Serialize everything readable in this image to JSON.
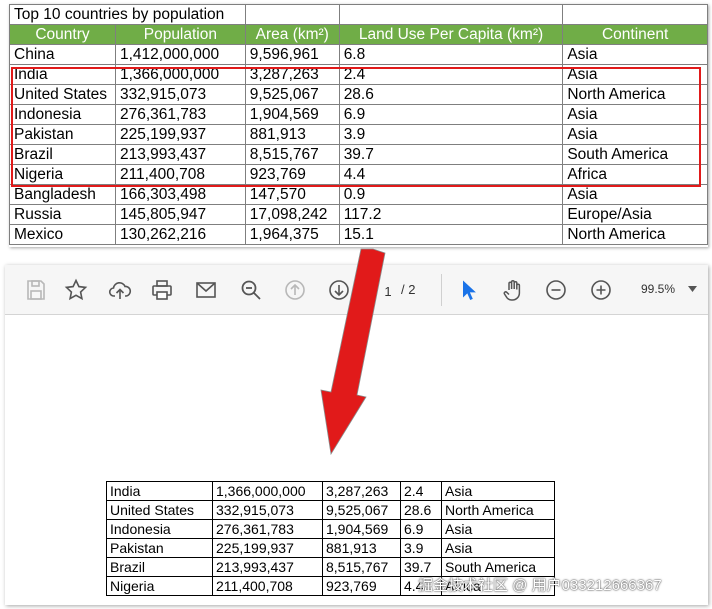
{
  "excel": {
    "title": "Top 10 countries by population",
    "headers": [
      "Country",
      "Population",
      "Area (km²)",
      "Land Use Per Capita (km²)",
      "Continent"
    ],
    "rows": [
      [
        "China",
        "1,412,000,000",
        "9,596,961",
        "6.8",
        "Asia"
      ],
      [
        "India",
        "1,366,000,000",
        "3,287,263",
        "2.4",
        "Asia"
      ],
      [
        "United States",
        "332,915,073",
        "9,525,067",
        "28.6",
        "North America"
      ],
      [
        "Indonesia",
        "276,361,783",
        "1,904,569",
        "6.9",
        "Asia"
      ],
      [
        "Pakistan",
        "225,199,937",
        "881,913",
        "3.9",
        "Asia"
      ],
      [
        "Brazil",
        "213,993,437",
        "8,515,767",
        "39.7",
        "South America"
      ],
      [
        "Nigeria",
        "211,400,708",
        "923,769",
        "4.4",
        "Africa"
      ],
      [
        "Bangladesh",
        "166,303,498",
        "147,570",
        "0.9",
        "Asia"
      ],
      [
        "Russia",
        "145,805,947",
        "17,098,242",
        "117.2",
        "Europe/Asia"
      ],
      [
        "Mexico",
        "130,262,216",
        "1,964,375",
        "15.1",
        "North America"
      ]
    ],
    "header_color": "#70ad47",
    "highlight_color": "#e11a1a"
  },
  "viewer": {
    "toolbar": {
      "page_current": "1",
      "page_total": "/ 2",
      "zoom": "99.5%"
    },
    "accent": "#1a73e8",
    "table_rows": [
      [
        "India",
        "1,366,000,000",
        "3,287,263",
        "2.4",
        "Asia"
      ],
      [
        "United States",
        "332,915,073",
        "9,525,067",
        "28.6",
        "North America"
      ],
      [
        "Indonesia",
        "276,361,783",
        "1,904,569",
        "6.9",
        "Asia"
      ],
      [
        "Pakistan",
        "225,199,937",
        "881,913",
        "3.9",
        "Asia"
      ],
      [
        "Brazil",
        "213,993,437",
        "8,515,767",
        "39.7",
        "South America"
      ],
      [
        "Nigeria",
        "211,400,708",
        "923,769",
        "4.4",
        "Africa"
      ]
    ]
  },
  "arrow_color": "#e11a1a",
  "watermark": "掘金技术社区 @ 用户033212666367"
}
